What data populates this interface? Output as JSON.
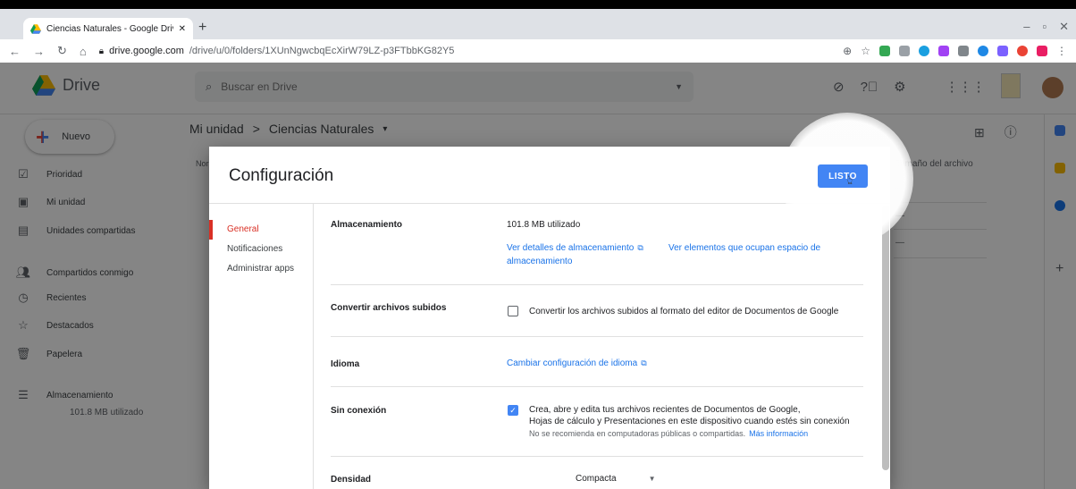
{
  "browser": {
    "tab_title": "Ciencias Naturales - Google Driv",
    "url_host": "drive.google.com",
    "url_path": "/drive/u/0/folders/1XUnNgwcbqEcXirW79LZ-p3FTbbKG82Y5"
  },
  "drive": {
    "logo_text": "Drive",
    "search_placeholder": "Buscar en Drive",
    "new_button": "Nuevo",
    "nav": [
      {
        "label": "Prioridad"
      },
      {
        "label": "Mi unidad"
      },
      {
        "label": "Unidades compartidas"
      },
      {
        "label": "Compartidos conmigo"
      },
      {
        "label": "Recientes"
      },
      {
        "label": "Destacados"
      },
      {
        "label": "Papelera"
      },
      {
        "label": "Almacenamiento"
      }
    ],
    "storage_used": "101.8 MB utilizado",
    "breadcrumb_root": "Mi unidad",
    "breadcrumb_sep": ">",
    "breadcrumb_current": "Ciencias Naturales",
    "col_name_partial": "Nor",
    "col_size": "Tamaño del archivo",
    "dash": "—"
  },
  "dialog": {
    "title": "Configuración",
    "done_button": "LISTO",
    "menu": [
      "General",
      "Notificaciones",
      "Administrar apps"
    ],
    "storage": {
      "label": "Almacenamiento",
      "value": "101.8 MB utilizado",
      "link1": "Ver detalles de almacenamiento",
      "link2_line1": "Ver elementos que ocupan espacio de",
      "link2_line2": "almacenamiento"
    },
    "convert": {
      "label": "Convertir archivos subidos",
      "text": "Convertir los archivos subidos al formato del editor de Documentos de Google"
    },
    "language": {
      "label": "Idioma",
      "link": "Cambiar configuración de idioma"
    },
    "offline": {
      "label": "Sin conexión",
      "line1": "Crea, abre y edita tus archivos recientes de Documentos de Google,",
      "line2": "Hojas de cálculo y Presentaciones en este dispositivo cuando estés sin conexión",
      "note": "No se recomienda en computadoras públicas o compartidas.",
      "more_link": "Más información"
    },
    "density": {
      "label": "Densidad",
      "value": "Compacta"
    }
  }
}
